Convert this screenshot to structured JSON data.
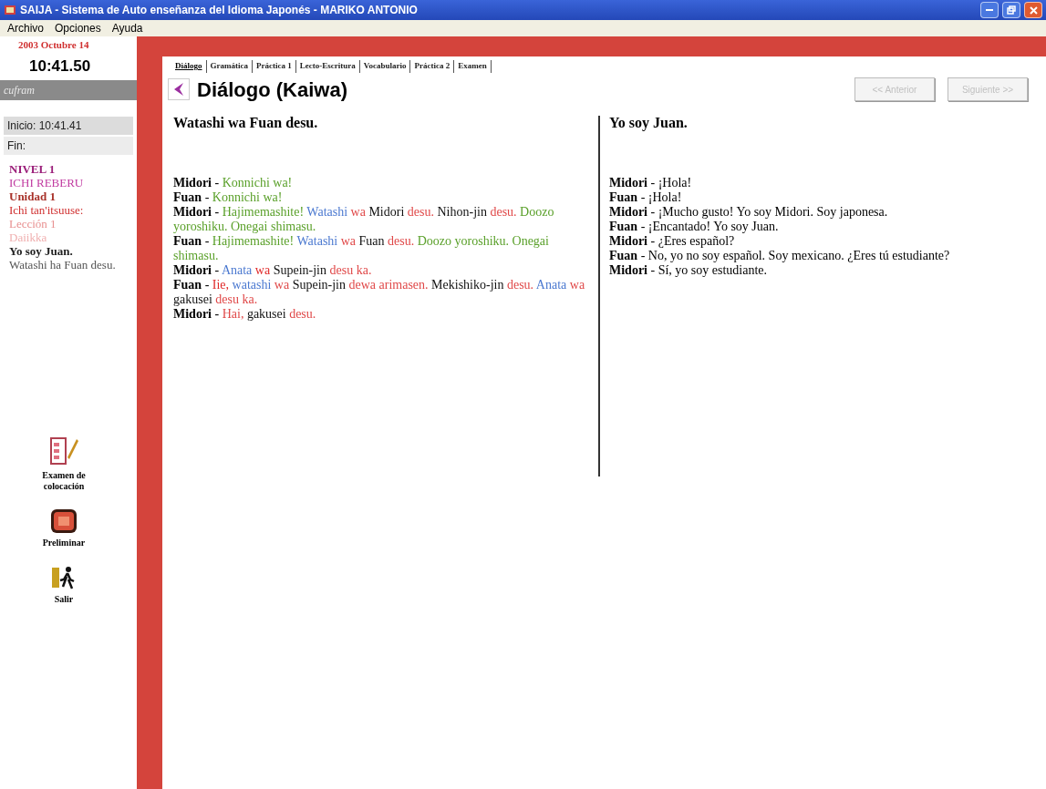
{
  "window": {
    "title": "SAIJA - Sistema de Auto enseñanza del Idioma Japonés - MARIKO ANTONIO"
  },
  "menu": [
    "Archivo",
    "Opciones",
    "Ayuda"
  ],
  "sidebar": {
    "date": "2003 Octubre 14",
    "time": "10:41.50",
    "user": "cufram",
    "start": "Inicio: 10:41.41",
    "end": "Fin:",
    "items": [
      {
        "text": "NIVEL 1",
        "color": "#9b1f7a",
        "bold": true
      },
      {
        "text": "ICHI REBERU",
        "color": "#c03aa0",
        "bold": false
      },
      {
        "text": "Unidad 1",
        "color": "#a8322a",
        "bold": true
      },
      {
        "text": "Ichi tan'itsuuse:",
        "color": "#d03030",
        "bold": false
      },
      {
        "text": "Lección 1",
        "color": "#e89090",
        "bold": false
      },
      {
        "text": "Daiikka",
        "color": "#f0b0b0",
        "bold": false
      },
      {
        "text": "Yo soy Juan.",
        "color": "#222222",
        "bold": true
      },
      {
        "text": "Watashi ha Fuan desu.",
        "color": "#555555",
        "bold": false
      }
    ],
    "actions": [
      {
        "label": "Examen de colocación",
        "kind": "exam"
      },
      {
        "label": "Preliminar",
        "kind": "book"
      },
      {
        "label": "Salir",
        "kind": "exit"
      }
    ]
  },
  "tabs": [
    {
      "label": "Diálogo",
      "selected": true
    },
    {
      "label": "Gramática",
      "selected": false
    },
    {
      "label": "Práctica 1",
      "selected": false
    },
    {
      "label": "Lecto-Escritura",
      "selected": false
    },
    {
      "label": "Vocabulario",
      "selected": false
    },
    {
      "label": "Práctica 2",
      "selected": false
    },
    {
      "label": "Examen",
      "selected": false
    }
  ],
  "heading": "Diálogo (Kaiwa)",
  "nav_buttons": [
    {
      "label": "<< Anterior",
      "disabled": true
    },
    {
      "label": "Siguiente >>",
      "disabled": true
    }
  ],
  "japanese": {
    "title": "Watashi wa Fuan desu.",
    "lines": [
      {
        "speaker": "Midori",
        "dash": "-",
        "segments": [
          {
            "text": "Konnichi wa!",
            "color": "#5aa02a"
          }
        ]
      },
      {
        "speaker": "Fuan",
        "dash": "-",
        "segments": [
          {
            "text": "Konnichi wa!",
            "color": "#5aa02a"
          }
        ]
      },
      {
        "speaker": "Midori",
        "dash": "-",
        "segments": [
          {
            "text": "Hajimemashite!",
            "color": "#5aa02a"
          },
          {
            "text": "Watashi",
            "color": "#4a78d0"
          },
          {
            "text": "wa",
            "color": "#e04848"
          },
          {
            "text": "Midori",
            "color": "#111111"
          },
          {
            "text": "desu.",
            "color": "#e04848"
          },
          {
            "text": "Nihon-jin",
            "color": "#111111"
          },
          {
            "text": "desu.",
            "color": "#e04848"
          },
          {
            "text": "Doozo yoroshiku. Onegai shimasu.",
            "color": "#5aa02a"
          }
        ]
      },
      {
        "speaker": "Fuan",
        "dash": "-",
        "segments": [
          {
            "text": "Hajimemashite!",
            "color": "#5aa02a"
          },
          {
            "text": "Watashi",
            "color": "#4a78d0"
          },
          {
            "text": "wa",
            "color": "#e04848"
          },
          {
            "text": "Fuan",
            "color": "#111111"
          },
          {
            "text": "desu.",
            "color": "#e04848"
          },
          {
            "text": "Doozo yoroshiku. Onegai shimasu.",
            "color": "#5aa02a"
          }
        ]
      },
      {
        "speaker": "Midori",
        "dash": "-",
        "segments": [
          {
            "text": "Anata",
            "color": "#4a78d0"
          },
          {
            "text": "wa",
            "color": "#e02828"
          },
          {
            "text": "Supein-jin",
            "color": "#111111"
          },
          {
            "text": "desu ka.",
            "color": "#e04848"
          }
        ]
      },
      {
        "speaker": "Fuan",
        "dash": "-",
        "segments": [
          {
            "text": "Iie,",
            "color": "#e02828"
          },
          {
            "text": "watashi",
            "color": "#4a78d0"
          },
          {
            "text": "wa",
            "color": "#e04848"
          },
          {
            "text": "Supein-jin",
            "color": "#111111"
          },
          {
            "text": "dewa arimasen.",
            "color": "#e04848"
          },
          {
            "text": "Mekishiko-jin",
            "color": "#111111"
          },
          {
            "text": "desu.",
            "color": "#e04848"
          },
          {
            "text": "Anata",
            "color": "#4a78d0"
          },
          {
            "text": "wa",
            "color": "#e04848"
          },
          {
            "text": "gakusei",
            "color": "#111111"
          },
          {
            "text": "desu ka.",
            "color": "#e04848"
          }
        ]
      },
      {
        "speaker": "Midori",
        "dash": "-",
        "segments": [
          {
            "text": "Hai,",
            "color": "#e04848"
          },
          {
            "text": "gakusei",
            "color": "#111111"
          },
          {
            "text": "desu.",
            "color": "#e04848"
          }
        ]
      }
    ]
  },
  "spanish": {
    "title": "Yo soy Juan.",
    "lines": [
      {
        "speaker": "Midori",
        "dash": "-",
        "text": "¡Hola!"
      },
      {
        "speaker": "Fuan",
        "dash": "-",
        "text": "¡Hola!"
      },
      {
        "speaker": "Midori",
        "dash": "-",
        "text": "¡Mucho gusto! Yo soy Midori. Soy japonesa."
      },
      {
        "speaker": "Fuan",
        "dash": "-",
        "text": "¡Encantado! Yo soy Juan."
      },
      {
        "speaker": "Midori",
        "dash": "-",
        "text": "¿Eres español?"
      },
      {
        "speaker": "Fuan",
        "dash": "-",
        "text": "No, yo no soy español. Soy mexicano. ¿Eres tú estudiante?"
      },
      {
        "speaker": "Midori",
        "dash": "-",
        "text": "Sí, yo soy estudiante."
      }
    ]
  }
}
